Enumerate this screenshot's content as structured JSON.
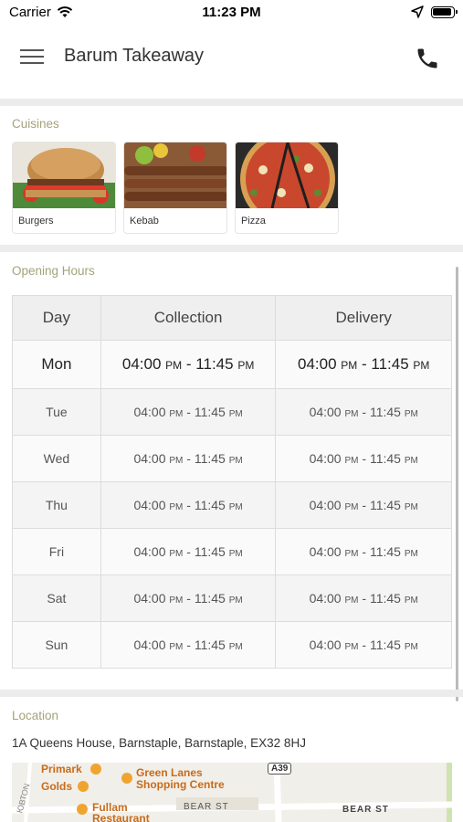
{
  "status_bar": {
    "carrier": "Carrier",
    "time": "11:23 PM"
  },
  "header": {
    "title": "Barum Takeaway"
  },
  "cuisines": {
    "title": "Cuisines",
    "items": [
      {
        "label": "Burgers"
      },
      {
        "label": "Kebab"
      },
      {
        "label": "Pizza"
      }
    ]
  },
  "opening_hours": {
    "title": "Opening Hours",
    "columns": [
      "Day",
      "Collection",
      "Delivery"
    ],
    "rows": [
      {
        "day": "Mon",
        "collection_open": "04:00",
        "collection_close": "11:45",
        "delivery_open": "04:00",
        "delivery_close": "11:45"
      },
      {
        "day": "Tue",
        "collection_open": "04:00",
        "collection_close": "11:45",
        "delivery_open": "04:00",
        "delivery_close": "11:45"
      },
      {
        "day": "Wed",
        "collection_open": "04:00",
        "collection_close": "11:45",
        "delivery_open": "04:00",
        "delivery_close": "11:45"
      },
      {
        "day": "Thu",
        "collection_open": "04:00",
        "collection_close": "11:45",
        "delivery_open": "04:00",
        "delivery_close": "11:45"
      },
      {
        "day": "Fri",
        "collection_open": "04:00",
        "collection_close": "11:45",
        "delivery_open": "04:00",
        "delivery_close": "11:45"
      },
      {
        "day": "Sat",
        "collection_open": "04:00",
        "collection_close": "11:45",
        "delivery_open": "04:00",
        "delivery_close": "11:45"
      },
      {
        "day": "Sun",
        "collection_open": "04:00",
        "collection_close": "11:45",
        "delivery_open": "04:00",
        "delivery_close": "11:45"
      }
    ],
    "period": "PM",
    "separator": "-"
  },
  "location": {
    "title": "Location",
    "address": "1A Queens House, Barnstaple, Barnstaple, EX32 8HJ",
    "map_labels": {
      "primark": "Primark",
      "golds": "Golds",
      "green_lanes": "Green Lanes",
      "shopping_centre": "Shopping Centre",
      "fullam": "Fullam",
      "restaurant": "Restaurant",
      "a39": "A39",
      "bear_st_1": "BEAR ST",
      "bear_st_2": "BEAR ST",
      "boutport": "ЮВТОN"
    }
  },
  "colors": {
    "section_title": "#a3a37a",
    "divider": "#ececec"
  },
  "icons": [
    "wifi-icon",
    "location-arrow-icon",
    "battery-icon",
    "hamburger-menu-icon",
    "phone-icon"
  ]
}
